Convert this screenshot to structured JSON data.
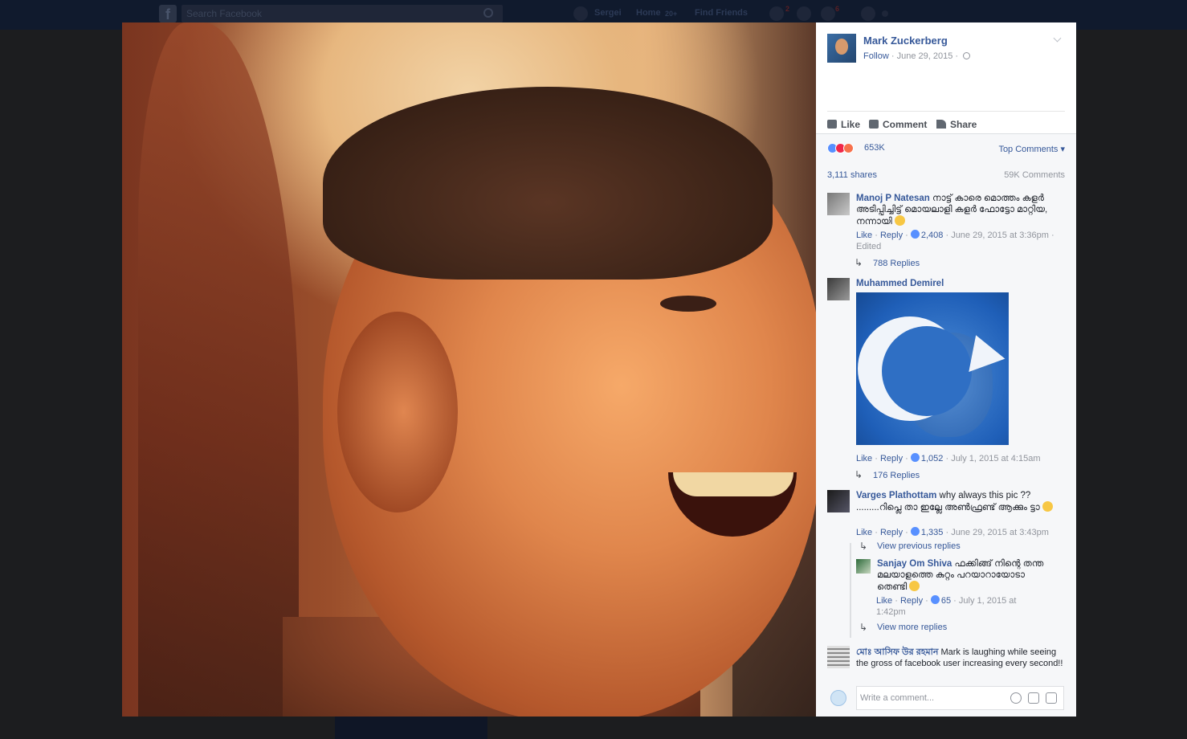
{
  "topbar": {
    "search_placeholder": "Search Facebook",
    "user": "Sergei",
    "home": "Home",
    "home_badge": "20+",
    "find_friends": "Find Friends",
    "friend_badge": "2",
    "notif_badge": "6"
  },
  "post": {
    "author": "Mark Zuckerberg",
    "follow": "Follow",
    "date": "June 29, 2015",
    "sep": "·",
    "actions": {
      "like": "Like",
      "comment": "Comment",
      "share": "Share"
    },
    "reactions_count": "653K",
    "top_comments": "Top Comments",
    "shares": "3,111 shares",
    "comments_count": "59K Comments"
  },
  "comments": [
    {
      "name": "Manoj P Natesan",
      "text": "നാട്ട് കാരെ മൊത്തം കളർ അടിപ്പിച്ചിട്ട് മൊയലാളി കളർ ഫോട്ടോ മാറ്റിയ, നന്നായി",
      "like": "Like",
      "reply": "Reply",
      "likes": "2,408",
      "time": "June 29, 2015 at 3:36pm",
      "edited": "Edited",
      "replies": "788 Replies"
    },
    {
      "name": "Muhammed Demirel",
      "like": "Like",
      "reply": "Reply",
      "likes": "1,052",
      "time": "July 1, 2015 at 4:15am",
      "replies": "176 Replies"
    },
    {
      "name": "Varges Plathottam",
      "text": "why always this pic ?? .........റിപ്ലെ താ ഇല്ലേ അൺഫ്രണ്ട് ആക്കും ട്ടാ",
      "like": "Like",
      "reply": "Reply",
      "likes": "1,335",
      "time": "June 29, 2015 at 3:43pm",
      "view_previous": "View previous replies",
      "reply_item": {
        "name": "Sanjay Om Shiva",
        "text": "ഫക്കിങ്ങ് നിന്റെ തന്ത മലയാളത്തെ കുറ്റം പറയാറായോടാ തെണ്ടി",
        "like": "Like",
        "reply": "Reply",
        "likes": "65",
        "time": "July 1, 2015 at 1:42pm"
      },
      "view_more": "View more replies"
    },
    {
      "name": "মোঃ আসিফ উর রহমান",
      "text": "Mark is laughing while seeing the gross of facebook user increasing every second!!"
    }
  ],
  "compose": {
    "placeholder": "Write a comment..."
  }
}
